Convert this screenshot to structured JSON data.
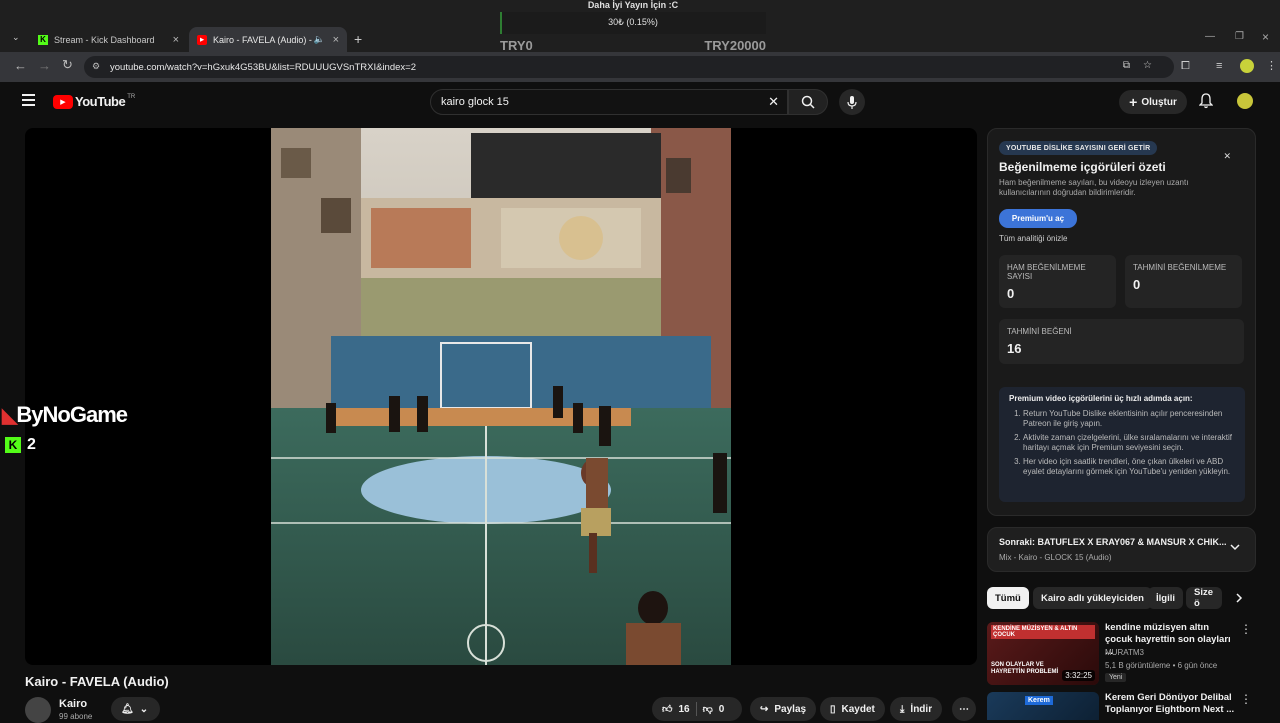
{
  "browser": {
    "tabs": [
      {
        "title": "Stream - Kick Dashboard",
        "icon": "kick-icon",
        "active": false
      },
      {
        "title": "Kairo - FAVELA (Audio) - Yo",
        "icon": "youtube-icon",
        "active": true
      }
    ],
    "url": "youtube.com/watch?v=hGxuk4G53BU&list=RDUUUGVSnTRXI&index=2"
  },
  "overlay": {
    "title": "Daha İyi Yayın İçin :C",
    "amount": "30₺ (0.15%)",
    "goal_min": "TRY0",
    "goal_max": "TRY20000",
    "progress_percent": 0.15
  },
  "youtube": {
    "logo_text": "YouTube",
    "region": "TR",
    "search_value": "kairo glock 15",
    "create_label": "Oluştur"
  },
  "stream_overlay": {
    "brand": "ByNoGame",
    "kick_count": "2"
  },
  "video": {
    "title": "Kairo - FAVELA (Audio)",
    "channel": "Kairo",
    "subscribers": "99 abone",
    "likes": "16",
    "dislikes": "0",
    "share_label": "Paylaş",
    "save_label": "Kaydet",
    "download_label": "İndir"
  },
  "dislike_panel": {
    "badge": "YOUTUBE DİSLİKE SAYISINI GERİ GETİR",
    "title": "Beğenilmeme içgörüleri özeti",
    "description": "Ham beğenilmeme sayıları, bu videoyu izleyen uzantı kullanıcılarının doğrudan bildirimleridir.",
    "premium_button": "Premium'u aç",
    "preview_link": "Tüm analitiği önizle",
    "stats": [
      {
        "label": "HAM BEĞENİLMEME SAYISI",
        "value": "0"
      },
      {
        "label": "TAHMİNİ BEĞENİLMEME",
        "value": "0"
      },
      {
        "label": "TAHMİNİ BEĞENİ",
        "value": "16"
      }
    ],
    "steps_title": "Premium video içgörülerini üç hızlı adımda açın:",
    "steps": [
      "Return YouTube Dislike eklentisinin açılır penceresinden Patreon ile giriş yapın.",
      "Aktivite zaman çizelgelerini, ülke sıralamalarını ve interaktif haritayı açmak için Premium seviyesini seçin.",
      "Her video için saatlik trendleri, öne çıkan ülkeleri ve ABD eyalet detaylarını görmek için YouTube'u yeniden yükleyin."
    ]
  },
  "next_up": {
    "title": "Sonraki: BATUFLEX X ERAY067 & MANSUR X CHIK...",
    "subtitle": "Mix - Kairo - GLOCK 15 (Audio)"
  },
  "chips": [
    "Tümü",
    "Kairo adlı yükleyiciden",
    "İlgili",
    "Size ö"
  ],
  "recommendations": [
    {
      "title": "kendine müzisyen altın çocuk hayrettin son olayları ...",
      "channel": "MURATM3",
      "meta": "5,1 B görüntüleme • 6 gün önce",
      "badge": "Yeni",
      "duration": "3:32:25",
      "thumb_top": "KENDİNE MÜZİSYEN & ALTIN ÇOCUK",
      "thumb_bottom": "SON OLAYLAR VE HAYRETTİN PROBLEMİ"
    },
    {
      "title": "Kerem Geri Dönüyor Delibal Toplanıyor Eightborn Next ...",
      "channel": "",
      "meta": "",
      "badge": "",
      "duration": "",
      "thumb_top": "Kerem",
      "thumb_bottom": ""
    }
  ]
}
